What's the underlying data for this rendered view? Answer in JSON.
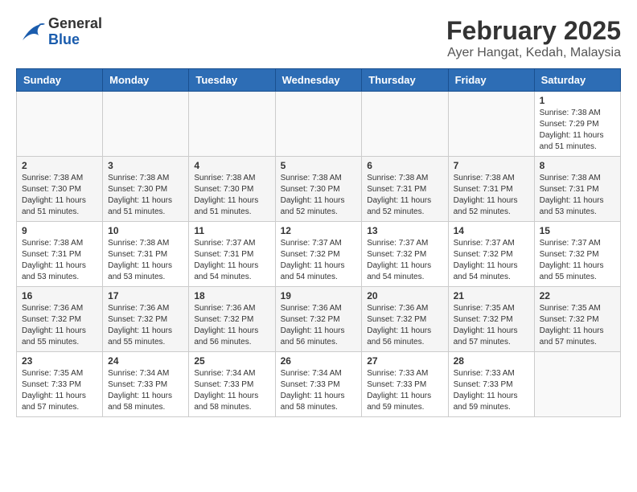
{
  "header": {
    "logo_general": "General",
    "logo_blue": "Blue",
    "month_title": "February 2025",
    "location": "Ayer Hangat, Kedah, Malaysia"
  },
  "days_of_week": [
    "Sunday",
    "Monday",
    "Tuesday",
    "Wednesday",
    "Thursday",
    "Friday",
    "Saturday"
  ],
  "weeks": [
    [
      {
        "day": "",
        "detail": ""
      },
      {
        "day": "",
        "detail": ""
      },
      {
        "day": "",
        "detail": ""
      },
      {
        "day": "",
        "detail": ""
      },
      {
        "day": "",
        "detail": ""
      },
      {
        "day": "",
        "detail": ""
      },
      {
        "day": "1",
        "detail": "Sunrise: 7:38 AM\nSunset: 7:29 PM\nDaylight: 11 hours\nand 51 minutes."
      }
    ],
    [
      {
        "day": "2",
        "detail": "Sunrise: 7:38 AM\nSunset: 7:30 PM\nDaylight: 11 hours\nand 51 minutes."
      },
      {
        "day": "3",
        "detail": "Sunrise: 7:38 AM\nSunset: 7:30 PM\nDaylight: 11 hours\nand 51 minutes."
      },
      {
        "day": "4",
        "detail": "Sunrise: 7:38 AM\nSunset: 7:30 PM\nDaylight: 11 hours\nand 51 minutes."
      },
      {
        "day": "5",
        "detail": "Sunrise: 7:38 AM\nSunset: 7:30 PM\nDaylight: 11 hours\nand 52 minutes."
      },
      {
        "day": "6",
        "detail": "Sunrise: 7:38 AM\nSunset: 7:31 PM\nDaylight: 11 hours\nand 52 minutes."
      },
      {
        "day": "7",
        "detail": "Sunrise: 7:38 AM\nSunset: 7:31 PM\nDaylight: 11 hours\nand 52 minutes."
      },
      {
        "day": "8",
        "detail": "Sunrise: 7:38 AM\nSunset: 7:31 PM\nDaylight: 11 hours\nand 53 minutes."
      }
    ],
    [
      {
        "day": "9",
        "detail": "Sunrise: 7:38 AM\nSunset: 7:31 PM\nDaylight: 11 hours\nand 53 minutes."
      },
      {
        "day": "10",
        "detail": "Sunrise: 7:38 AM\nSunset: 7:31 PM\nDaylight: 11 hours\nand 53 minutes."
      },
      {
        "day": "11",
        "detail": "Sunrise: 7:37 AM\nSunset: 7:31 PM\nDaylight: 11 hours\nand 54 minutes."
      },
      {
        "day": "12",
        "detail": "Sunrise: 7:37 AM\nSunset: 7:32 PM\nDaylight: 11 hours\nand 54 minutes."
      },
      {
        "day": "13",
        "detail": "Sunrise: 7:37 AM\nSunset: 7:32 PM\nDaylight: 11 hours\nand 54 minutes."
      },
      {
        "day": "14",
        "detail": "Sunrise: 7:37 AM\nSunset: 7:32 PM\nDaylight: 11 hours\nand 54 minutes."
      },
      {
        "day": "15",
        "detail": "Sunrise: 7:37 AM\nSunset: 7:32 PM\nDaylight: 11 hours\nand 55 minutes."
      }
    ],
    [
      {
        "day": "16",
        "detail": "Sunrise: 7:36 AM\nSunset: 7:32 PM\nDaylight: 11 hours\nand 55 minutes."
      },
      {
        "day": "17",
        "detail": "Sunrise: 7:36 AM\nSunset: 7:32 PM\nDaylight: 11 hours\nand 55 minutes."
      },
      {
        "day": "18",
        "detail": "Sunrise: 7:36 AM\nSunset: 7:32 PM\nDaylight: 11 hours\nand 56 minutes."
      },
      {
        "day": "19",
        "detail": "Sunrise: 7:36 AM\nSunset: 7:32 PM\nDaylight: 11 hours\nand 56 minutes."
      },
      {
        "day": "20",
        "detail": "Sunrise: 7:36 AM\nSunset: 7:32 PM\nDaylight: 11 hours\nand 56 minutes."
      },
      {
        "day": "21",
        "detail": "Sunrise: 7:35 AM\nSunset: 7:32 PM\nDaylight: 11 hours\nand 57 minutes."
      },
      {
        "day": "22",
        "detail": "Sunrise: 7:35 AM\nSunset: 7:32 PM\nDaylight: 11 hours\nand 57 minutes."
      }
    ],
    [
      {
        "day": "23",
        "detail": "Sunrise: 7:35 AM\nSunset: 7:33 PM\nDaylight: 11 hours\nand 57 minutes."
      },
      {
        "day": "24",
        "detail": "Sunrise: 7:34 AM\nSunset: 7:33 PM\nDaylight: 11 hours\nand 58 minutes."
      },
      {
        "day": "25",
        "detail": "Sunrise: 7:34 AM\nSunset: 7:33 PM\nDaylight: 11 hours\nand 58 minutes."
      },
      {
        "day": "26",
        "detail": "Sunrise: 7:34 AM\nSunset: 7:33 PM\nDaylight: 11 hours\nand 58 minutes."
      },
      {
        "day": "27",
        "detail": "Sunrise: 7:33 AM\nSunset: 7:33 PM\nDaylight: 11 hours\nand 59 minutes."
      },
      {
        "day": "28",
        "detail": "Sunrise: 7:33 AM\nSunset: 7:33 PM\nDaylight: 11 hours\nand 59 minutes."
      },
      {
        "day": "",
        "detail": ""
      }
    ]
  ]
}
